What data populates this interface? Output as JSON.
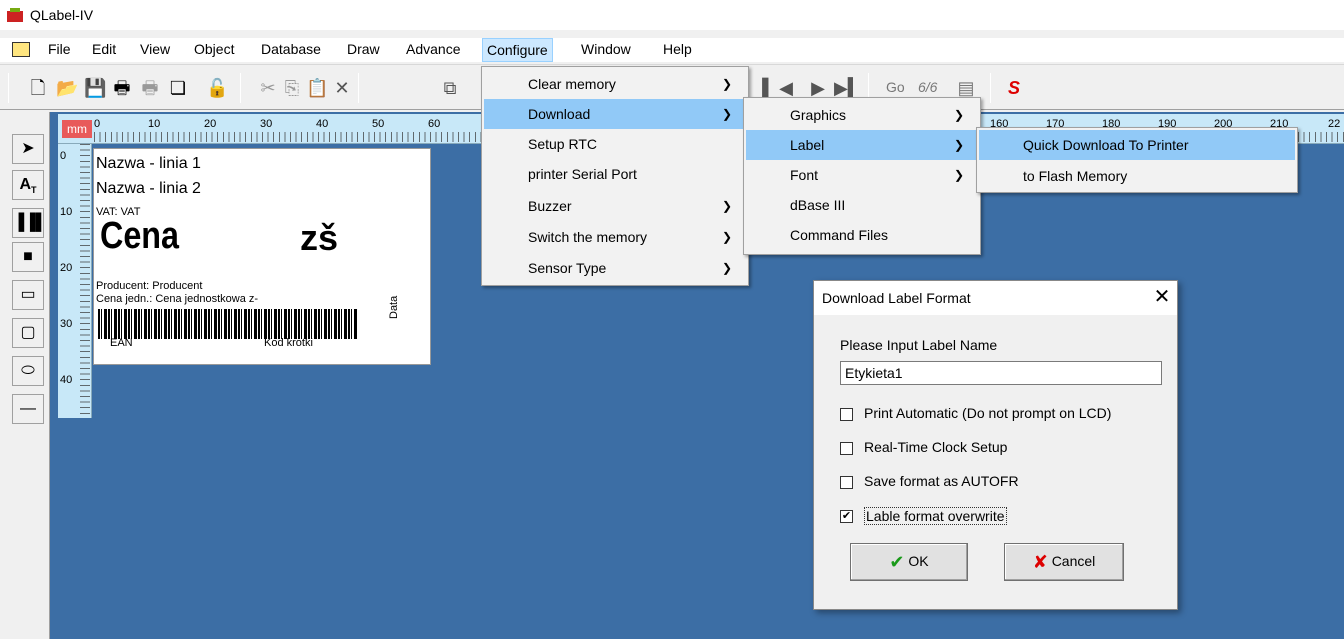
{
  "window": {
    "title": "QLabel-IV"
  },
  "menubar": [
    "File",
    "Edit",
    "View",
    "Object",
    "Database",
    "Draw",
    "Advance",
    "Configure",
    "Window",
    "Help"
  ],
  "toolbar": {
    "go_label": "Go",
    "go2_label": "6/6"
  },
  "ruler": {
    "unit": "mm",
    "top_ticks": [
      "0",
      "10",
      "20",
      "30",
      "40",
      "50",
      "60",
      "160",
      "170",
      "180",
      "190",
      "200",
      "210",
      "22"
    ],
    "left_ticks": [
      "0",
      "10",
      "20",
      "30",
      "40"
    ]
  },
  "label": {
    "line1": "Nazwa - linia 1",
    "line2": "Nazwa - linia 2",
    "vat": "VAT: VAT",
    "cena": "Cena",
    "zs": "zš",
    "producent": "Producent: Producent",
    "cena_jedn": "Cena jedn.: Cena jednostkowa z-",
    "ean": "EAN",
    "kod": "Kod krotki",
    "data": "Data"
  },
  "configure_menu": [
    {
      "label": "Clear memory",
      "submenu": true
    },
    {
      "label": "Download",
      "submenu": true,
      "highlighted": true
    },
    {
      "label": "Setup RTC",
      "submenu": false
    },
    {
      "label": "printer Serial Port",
      "submenu": false
    },
    {
      "label": "Buzzer",
      "submenu": true
    },
    {
      "label": "Switch the memory",
      "submenu": true
    },
    {
      "label": "Sensor Type",
      "submenu": true
    }
  ],
  "download_menu": [
    {
      "label": "Graphics",
      "submenu": true
    },
    {
      "label": "Label",
      "submenu": true,
      "highlighted": true
    },
    {
      "label": "Font",
      "submenu": true
    },
    {
      "label": "dBase III",
      "submenu": false
    },
    {
      "label": "Command Files",
      "submenu": false
    }
  ],
  "label_menu": [
    {
      "label": "Quick Download To Printer",
      "highlighted": true
    },
    {
      "label": "to Flash Memory"
    }
  ],
  "dialog": {
    "title": "Download Label Format",
    "prompt": "Please Input Label Name",
    "input_value": "Etykieta1",
    "checkboxes": [
      {
        "label": "Print Automatic (Do not prompt on LCD)",
        "checked": false
      },
      {
        "label": "Real-Time Clock Setup",
        "checked": false
      },
      {
        "label": "Save format as AUTOFR",
        "checked": false
      },
      {
        "label": "Lable format overwrite",
        "checked": true
      }
    ],
    "ok_label": "OK",
    "cancel_label": "Cancel"
  },
  "colors": {
    "workspace": "#3c6ea5",
    "menu_highlight": "#91c9f7",
    "ruler": "#c8e8f8"
  }
}
